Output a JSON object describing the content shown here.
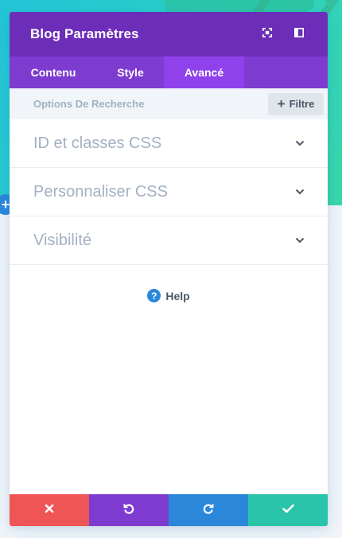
{
  "modal": {
    "title": "Blog Paramètres",
    "header_icons": [
      "fullscreen-icon",
      "sidebar-toggle-icon"
    ]
  },
  "tabs": [
    {
      "label": "Contenu",
      "active": false
    },
    {
      "label": "Style",
      "active": false
    },
    {
      "label": "Avancé",
      "active": true
    }
  ],
  "search": {
    "placeholder": "Options De Recherche",
    "value": ""
  },
  "filter": {
    "label": "Filtre",
    "icon": "plus-icon"
  },
  "toggles": [
    {
      "label": "ID et classes CSS",
      "icon": "chevron-down-icon"
    },
    {
      "label": "Personnaliser CSS",
      "icon": "chevron-down-icon"
    },
    {
      "label": "Visibilité",
      "icon": "chevron-down-icon"
    }
  ],
  "help": {
    "label": "Help",
    "icon_glyph": "?"
  },
  "footer": {
    "buttons": [
      {
        "name": "cancel",
        "icon": "close-icon",
        "color": "#ef5555"
      },
      {
        "name": "undo",
        "icon": "undo-icon",
        "color": "#7e3bd0"
      },
      {
        "name": "redo",
        "icon": "redo-icon",
        "color": "#2b87da"
      },
      {
        "name": "save",
        "icon": "check-icon",
        "color": "#29c4a9"
      }
    ]
  },
  "colors": {
    "header": "#6c2eb9",
    "tabs": "#7e3bd0",
    "active_tab": "#8f42ec",
    "accent_blue": "#2b87da",
    "toggle_text": "#a3b0c2"
  }
}
